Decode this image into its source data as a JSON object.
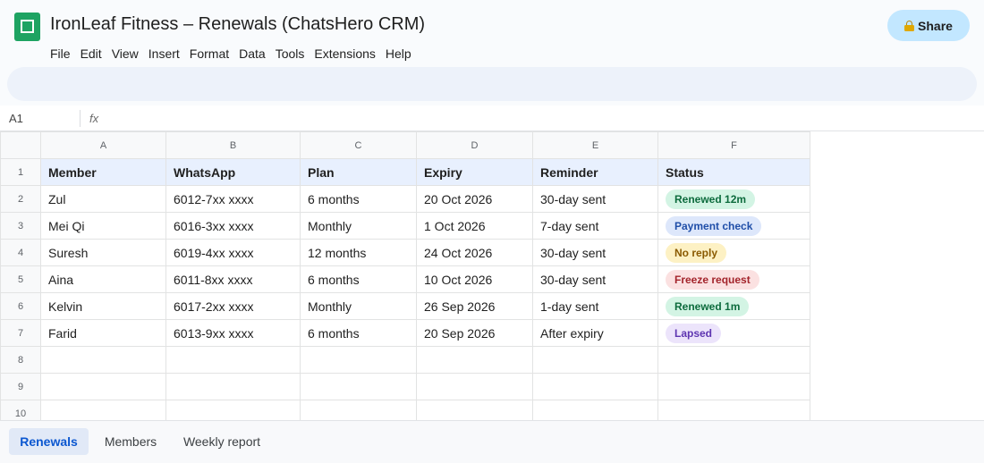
{
  "document": {
    "title": "IronLeaf Fitness – Renewals (ChatsHero CRM)",
    "share_label": "Share"
  },
  "menu": [
    "File",
    "Edit",
    "View",
    "Insert",
    "Format",
    "Data",
    "Tools",
    "Extensions",
    "Help"
  ],
  "formula_bar": {
    "cell_ref": "A1",
    "fx_label": "fx",
    "value": ""
  },
  "sheet": {
    "column_letters": [
      "A",
      "B",
      "C",
      "D",
      "E",
      "F"
    ],
    "row_numbers": [
      "1",
      "2",
      "3",
      "4",
      "5",
      "6",
      "7",
      "8",
      "9",
      "10"
    ],
    "headers": [
      "Member",
      "WhatsApp",
      "Plan",
      "Expiry",
      "Reminder",
      "Status"
    ],
    "rows": [
      {
        "member": "Zul",
        "whatsapp": "6012-7xx xxxx",
        "plan": "6 months",
        "expiry": "20 Oct 2026",
        "reminder": "30-day sent",
        "status": "Renewed 12m",
        "status_color": "green"
      },
      {
        "member": "Mei Qi",
        "whatsapp": "6016-3xx xxxx",
        "plan": "Monthly",
        "expiry": "1 Oct 2026",
        "reminder": "7-day sent",
        "status": "Payment check",
        "status_color": "blue"
      },
      {
        "member": "Suresh",
        "whatsapp": "6019-4xx xxxx",
        "plan": "12 months",
        "expiry": "24 Oct 2026",
        "reminder": "30-day sent",
        "status": "No reply",
        "status_color": "yellow"
      },
      {
        "member": "Aina",
        "whatsapp": "6011-8xx xxxx",
        "plan": "6 months",
        "expiry": "10 Oct 2026",
        "reminder": "30-day sent",
        "status": "Freeze request",
        "status_color": "red"
      },
      {
        "member": "Kelvin",
        "whatsapp": "6017-2xx xxxx",
        "plan": "Monthly",
        "expiry": "26 Sep 2026",
        "reminder": "1-day sent",
        "status": "Renewed 1m",
        "status_color": "green"
      },
      {
        "member": "Farid",
        "whatsapp": "6013-9xx xxxx",
        "plan": "6 months",
        "expiry": "20 Sep 2026",
        "reminder": "After expiry",
        "status": "Lapsed",
        "status_color": "purple"
      }
    ]
  },
  "tabs": [
    {
      "label": "Renewals",
      "active": true
    },
    {
      "label": "Members",
      "active": false
    },
    {
      "label": "Weekly report",
      "active": false
    }
  ],
  "colors": {
    "brand_green": "#1ea362",
    "share_button": "#c2e7ff",
    "header_row": "#e8f0fe",
    "active_tab": "#0b57d0"
  }
}
